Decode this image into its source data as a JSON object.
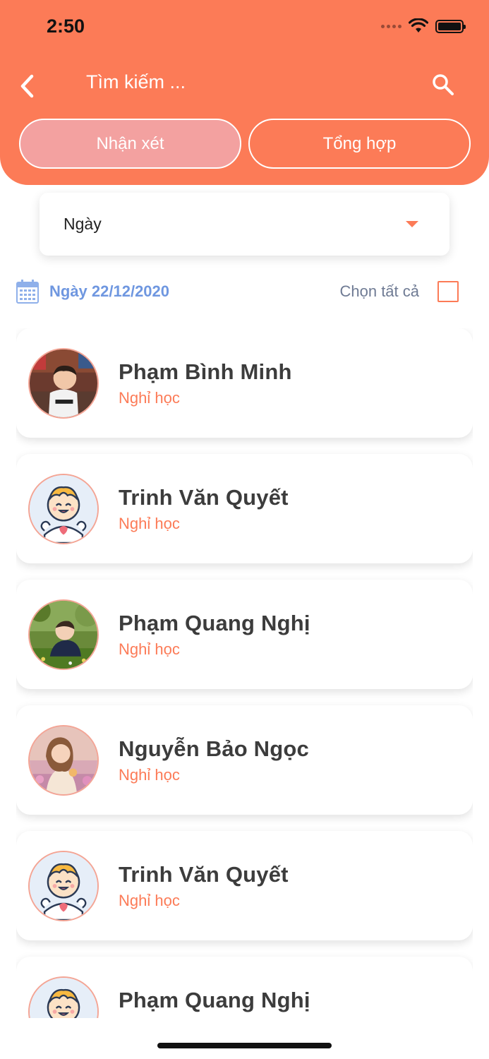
{
  "status_bar": {
    "time": "2:50"
  },
  "header": {
    "search_placeholder": "Tìm kiếm ...",
    "tabs": [
      {
        "label": "Nhận xét",
        "active": true
      },
      {
        "label": "Tổng hợp",
        "active": false
      }
    ]
  },
  "filter": {
    "selected": "Ngày"
  },
  "date_row": {
    "date_label": "Ngày 22/12/2020",
    "select_all_label": "Chọn tất cả",
    "select_all_checked": false
  },
  "students": [
    {
      "name": "Phạm Bình Minh",
      "status": "Nghỉ học",
      "avatar": "photo-boy-indoor"
    },
    {
      "name": "Trinh Văn Quyết",
      "status": "Nghỉ học",
      "avatar": "cartoon-baby-icon"
    },
    {
      "name": "Phạm Quang Nghị",
      "status": "Nghỉ học",
      "avatar": "photo-boy-grass"
    },
    {
      "name": "Nguyễn Bảo Ngọc",
      "status": "Nghỉ học",
      "avatar": "photo-girl-flowers"
    },
    {
      "name": "Trinh Văn Quyết",
      "status": "Nghỉ học",
      "avatar": "cartoon-baby-icon"
    },
    {
      "name": "Phạm Quang Nghị",
      "status": "",
      "avatar": "cartoon-baby-icon"
    }
  ],
  "colors": {
    "accent": "#FC7B57",
    "tab_active": "#F3A1A0",
    "date_blue": "#6F97E0"
  }
}
